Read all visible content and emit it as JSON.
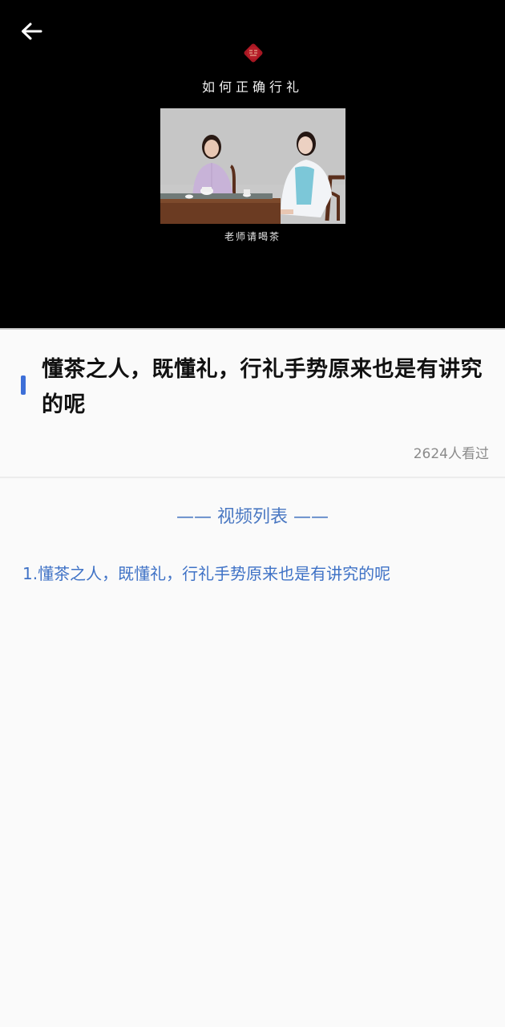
{
  "player": {
    "video_title": "如何正确行礼",
    "subtitle": "老师请喝茶",
    "seal_text": "茶礼"
  },
  "header": {
    "back_icon": "arrow-left-icon"
  },
  "info": {
    "title": "懂茶之人，既懂礼，行礼手势原来也是有讲究的呢",
    "views": "2624人看过"
  },
  "list": {
    "header": "—— 视频列表 ——",
    "items": [
      {
        "label": "1.懂茶之人，既懂礼，行礼手势原来也是有讲究的呢"
      }
    ]
  },
  "colors": {
    "accent": "#3d6fd8",
    "list_text": "#3f72c6",
    "seal": "#a61722"
  }
}
